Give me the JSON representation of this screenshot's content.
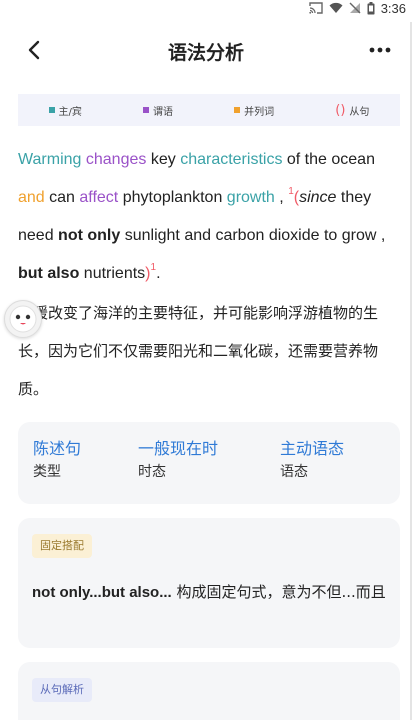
{
  "status_bar": {
    "time": "3:36"
  },
  "header": {
    "title": "语法分析"
  },
  "legend": {
    "items": [
      {
        "label": "主/宾",
        "color": "#3aa2a7"
      },
      {
        "label": "谓语",
        "color": "#9a52c8"
      },
      {
        "label": "并列词",
        "color": "#f0a12e"
      }
    ],
    "clause_marker": "()",
    "clause_label": "从句",
    "clause_color": "#f05a66"
  },
  "sentence": {
    "words": [
      {
        "t": "Warming",
        "k": "subj"
      },
      {
        "t": "changes",
        "k": "pred"
      },
      {
        "t": "key",
        "k": "plain"
      },
      {
        "t": "characteristics",
        "k": "subj"
      },
      {
        "t": "of the ocean",
        "k": "plain"
      },
      {
        "t": "and",
        "k": "conj"
      },
      {
        "t": "can",
        "k": "plain"
      },
      {
        "t": "affect",
        "k": "pred"
      },
      {
        "t": "phytoplankton",
        "k": "plain"
      },
      {
        "t": "growth",
        "k": "subj"
      },
      {
        "t": ",",
        "k": "plain"
      }
    ],
    "clause_sup": "1",
    "clause_words": [
      {
        "t": "since",
        "k": "ital"
      },
      {
        "t": "they need",
        "k": "plain"
      },
      {
        "t": "not only",
        "k": "bold"
      },
      {
        "t": "sunlight and carbon dioxide to grow ,",
        "k": "plain"
      },
      {
        "t": "but also",
        "k": "bold"
      },
      {
        "t": "nutrients",
        "k": "plain"
      }
    ],
    "end": "."
  },
  "translation": "变暖改变了海洋的主要特征，并可能影响浮游植物的生长，因为它们不仅需要阳光和二氧化碳，还需要营养物质。",
  "type_card": {
    "columns": [
      {
        "value": "陈述句",
        "label": "类型"
      },
      {
        "value": "一般现在时",
        "label": "时态"
      },
      {
        "value": "主动语态",
        "label": "语态"
      }
    ]
  },
  "phrase_card": {
    "tag": "固定搭配",
    "key": "not only...but also...",
    "desc": "构成固定句式，意为不但...而且"
  },
  "clause_card": {
    "tag": "从句解析"
  }
}
